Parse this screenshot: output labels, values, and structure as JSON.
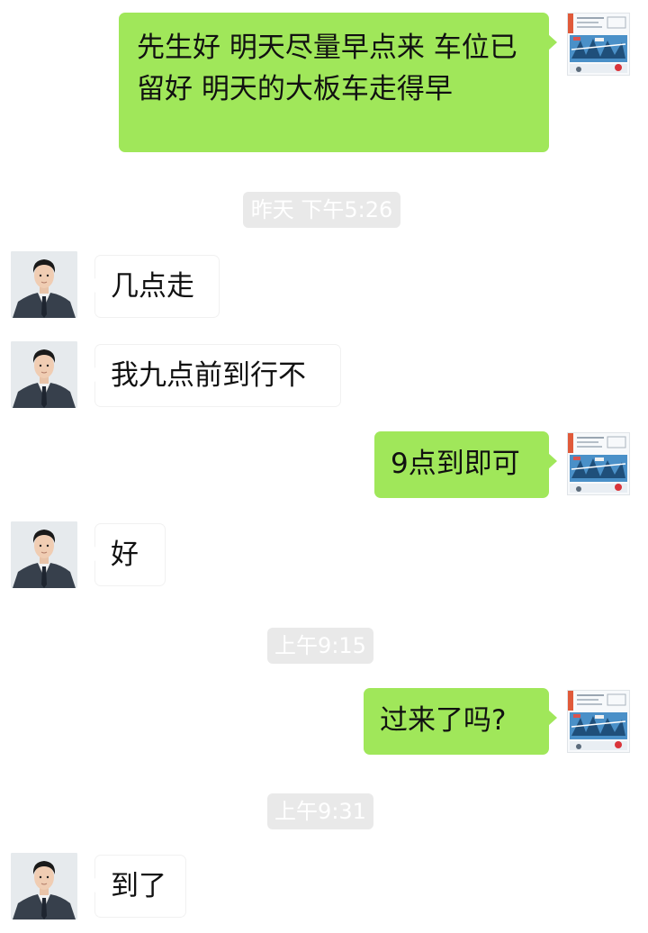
{
  "messages": [
    {
      "side": "out",
      "text": "先生好   明天尽量早点来   车位已留好   明天的大板车走得早"
    },
    {
      "type": "timestamp",
      "text": "昨天 下午5:26"
    },
    {
      "side": "in",
      "text": "几点走"
    },
    {
      "side": "in",
      "text": "我九点前到行不"
    },
    {
      "side": "out",
      "text": "9点到即可"
    },
    {
      "side": "in",
      "text": "好"
    },
    {
      "type": "timestamp",
      "text": "上午9:15"
    },
    {
      "side": "out",
      "text": "过来了吗?"
    },
    {
      "type": "timestamp",
      "text": "上午9:31"
    },
    {
      "side": "in",
      "text": "到了"
    }
  ],
  "avatars": {
    "self": "car-transport-company-logo",
    "contact": "man-in-suit-photo"
  },
  "colors": {
    "outgoing_bubble": "#a0e75a",
    "incoming_bubble": "#ffffff",
    "timestamp_pill": "#e9e9e9",
    "background": "#ffffff"
  }
}
